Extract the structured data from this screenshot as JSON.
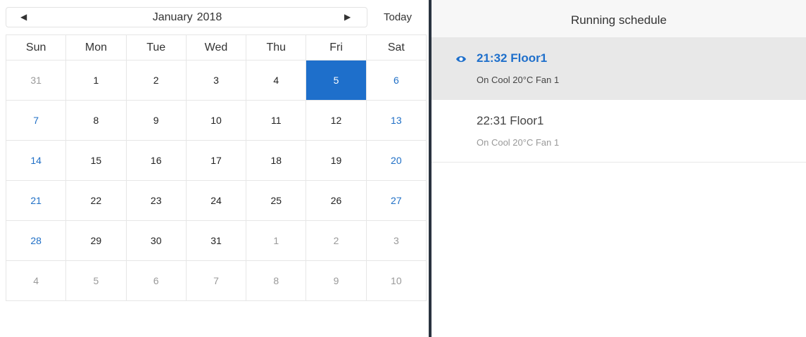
{
  "calendar": {
    "prev_icon": "triangle-left-icon",
    "next_icon": "triangle-right-icon",
    "month": "January",
    "year": "2018",
    "today_label": "Today",
    "weekdays": [
      "Sun",
      "Mon",
      "Tue",
      "Wed",
      "Thu",
      "Fri",
      "Sat"
    ],
    "weeks": [
      [
        {
          "d": "31",
          "t": "other"
        },
        {
          "d": "1"
        },
        {
          "d": "2"
        },
        {
          "d": "3"
        },
        {
          "d": "4"
        },
        {
          "d": "5",
          "t": "selected"
        },
        {
          "d": "6",
          "t": "weekend"
        }
      ],
      [
        {
          "d": "7",
          "t": "weekend"
        },
        {
          "d": "8"
        },
        {
          "d": "9"
        },
        {
          "d": "10"
        },
        {
          "d": "11"
        },
        {
          "d": "12"
        },
        {
          "d": "13",
          "t": "weekend"
        }
      ],
      [
        {
          "d": "14",
          "t": "weekend"
        },
        {
          "d": "15"
        },
        {
          "d": "16"
        },
        {
          "d": "17"
        },
        {
          "d": "18"
        },
        {
          "d": "19"
        },
        {
          "d": "20",
          "t": "weekend"
        }
      ],
      [
        {
          "d": "21",
          "t": "weekend"
        },
        {
          "d": "22"
        },
        {
          "d": "23"
        },
        {
          "d": "24"
        },
        {
          "d": "25"
        },
        {
          "d": "26"
        },
        {
          "d": "27",
          "t": "weekend"
        }
      ],
      [
        {
          "d": "28",
          "t": "weekend"
        },
        {
          "d": "29"
        },
        {
          "d": "30"
        },
        {
          "d": "31"
        },
        {
          "d": "1",
          "t": "other"
        },
        {
          "d": "2",
          "t": "other"
        },
        {
          "d": "3",
          "t": "other"
        }
      ],
      [
        {
          "d": "4",
          "t": "other"
        },
        {
          "d": "5",
          "t": "other"
        },
        {
          "d": "6",
          "t": "other"
        },
        {
          "d": "7",
          "t": "other"
        },
        {
          "d": "8",
          "t": "other"
        },
        {
          "d": "9",
          "t": "other"
        },
        {
          "d": "10",
          "t": "other"
        }
      ]
    ],
    "colors": {
      "selected": "#1e6fcb",
      "weekend": "#1f6fc6",
      "other": "#999999"
    }
  },
  "schedule": {
    "title": "Running schedule",
    "items": [
      {
        "time": "21:32",
        "name": "Floor1",
        "detail": "On Cool 20°C Fan 1",
        "active": true,
        "icon": "eye-icon"
      },
      {
        "time": "22:31",
        "name": "Floor1",
        "detail": "On Cool 20°C Fan 1",
        "active": false
      }
    ]
  },
  "colors": {
    "accent": "#1e6fcb",
    "divider": "#2a3340"
  }
}
